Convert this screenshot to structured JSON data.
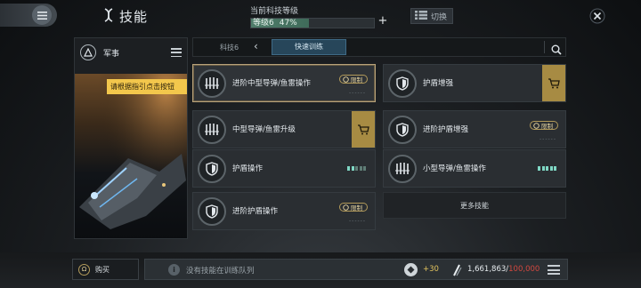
{
  "header": {
    "title": "技能",
    "tech_level_label": "当前科技等级",
    "tech_level_value": "等级6",
    "tech_level_pct": "47%",
    "tech_level_progress": 0.47,
    "switch_label": "切换"
  },
  "left_panel": {
    "category_label": "军事",
    "hint_text": "请根据指引点击按钮"
  },
  "filter": {
    "breadcrumb": "科技6",
    "quick_train_tab": "快速训练"
  },
  "skills": [
    {
      "name": "进阶中型导弹/鱼雷操作",
      "tag": "限制",
      "progress_text": "------",
      "icon": "missile-icon",
      "buy": true
    },
    {
      "name": "护盾增强",
      "icon": "shield-icon",
      "buy": true
    },
    {
      "name": "中型导弹/鱼雷升级",
      "icon": "missile-icon",
      "buy": true
    },
    {
      "name": "进阶护盾增强",
      "tag": "限制",
      "progress_text": "------",
      "icon": "shield-icon"
    },
    {
      "name": "护盾操作",
      "icon": "shield-icon",
      "level": 2,
      "max_level": 5
    },
    {
      "name": "小型导弹/鱼雷操作",
      "icon": "missile-icon",
      "level": 5,
      "max_level": 5
    },
    {
      "name": "进阶护盾操作",
      "tag": "限制",
      "progress_text": "------",
      "icon": "shield-icon"
    }
  ],
  "more_skills_label": "更多技能",
  "footer": {
    "buy_label": "购买",
    "queue_text": "没有技能在训练队列",
    "skill_points": "+30",
    "isk_current": "1,661,863",
    "isk_separator": "/",
    "isk_cap": "100,000"
  },
  "colors": {
    "accent_gold": "#a78b43",
    "accent_teal": "#7fd7c4",
    "isk_cap_red": "#d2483f",
    "hint_yellow": "#f3c74c"
  }
}
